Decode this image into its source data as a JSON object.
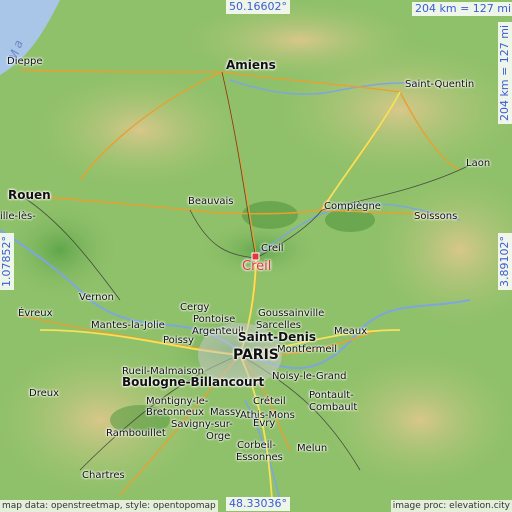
{
  "coords": {
    "north": "50.16602°",
    "south": "48.33036°",
    "west": "1.07852°",
    "east": "3.89102°"
  },
  "scale": {
    "top": "204 km = 127 mi",
    "right": "204 km = 127 mi"
  },
  "sea_text": "Ma",
  "target": "Creil",
  "cities": {
    "dieppe": "Dieppe",
    "amiens": "Amiens",
    "saint_quentin": "Saint-Quentin",
    "laon": "Laon",
    "rouen": "Rouen",
    "ille_les": "ille-lès-",
    "beauvais": "Beauvais",
    "compiegne": "Compiègne",
    "soissons": "Soissons",
    "creil_small": "Creil",
    "vernon": "Vernon",
    "evreux": "Évreux",
    "cergy": "Cergy",
    "pontoise": "Pontoise",
    "goussainville": "Goussainville",
    "mantes": "Mantes-la-Jolie",
    "argenteuil": "Argenteuil",
    "sarcelles": "Sarcelles",
    "saint_denis": "Saint-Denis",
    "meaux": "Meaux",
    "poissy": "Poissy",
    "montfermeil": "Montfermeil",
    "paris": "PARIS",
    "rueil": "Rueil-Malmaison",
    "noisy": "Noisy-le-Grand",
    "boulogne": "Boulogne-Billancourt",
    "dreux": "Dreux",
    "montigny": "Montigny-le-",
    "creteil": "Créteil",
    "pontault": "Pontault-",
    "combault": "Combault",
    "bretonneux": "Bretonneux",
    "massy": "Massy",
    "athis": "Athis-Mons",
    "rambouillet": "Rambouillet",
    "savigny": "Savigny-sur-",
    "orge": "Orge",
    "evry": "Évry",
    "corbeil": "Corbeil-",
    "essonnes": "Essonnes",
    "melun": "Melun",
    "chartres": "Chartres"
  },
  "attribution": {
    "left": "map data: openstreetmap, style: opentopomap",
    "right": "image proc: elevation.city"
  },
  "colors": {
    "target": "#e8343a",
    "coord_text": "#3b5bd6",
    "lowland": "#8fc06a",
    "water": "#a9c6e8"
  }
}
